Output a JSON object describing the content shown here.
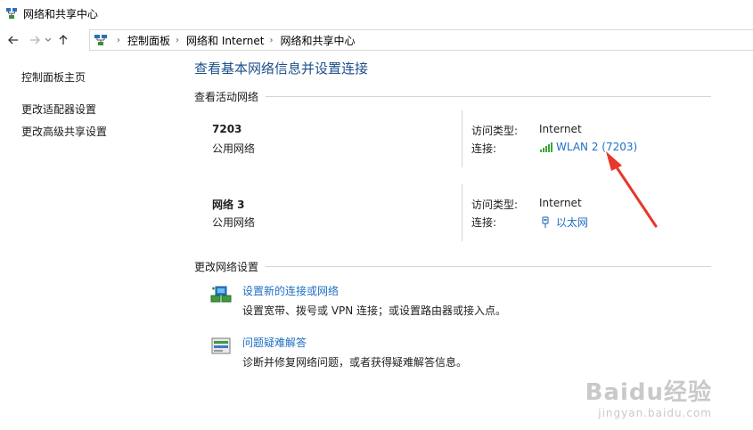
{
  "window": {
    "title": "网络和共享中心"
  },
  "nav": {
    "back_icon": "arrow-left-icon",
    "forward_icon": "arrow-right-icon",
    "recent_icon": "chevron-down-icon",
    "up_icon": "arrow-up-icon",
    "breadcrumbs": [
      "控制面板",
      "网络和 Internet",
      "网络和共享中心"
    ]
  },
  "sidebar": {
    "items": [
      {
        "label": "控制面板主页"
      },
      {
        "label": "更改适配器设置"
      },
      {
        "label": "更改高级共享设置"
      }
    ]
  },
  "main": {
    "heading": "查看基本网络信息并设置连接",
    "active_networks_header": "查看活动网络",
    "networks": [
      {
        "name": "7203",
        "category": "公用网络",
        "access_type_label": "访问类型:",
        "access_type_value": "Internet",
        "connection_label": "连接:",
        "connection_value": "WLAN 2 (7203)",
        "connection_icon": "wifi-signal-icon"
      },
      {
        "name": "网络  3",
        "category": "公用网络",
        "access_type_label": "访问类型:",
        "access_type_value": "Internet",
        "connection_label": "连接:",
        "connection_value": "以太网",
        "connection_icon": "ethernet-icon"
      }
    ],
    "change_settings_header": "更改网络设置",
    "tasks": [
      {
        "link": "设置新的连接或网络",
        "description": "设置宽带、拨号或 VPN 连接；或设置路由器或接入点。",
        "icon": "new-connection-icon"
      },
      {
        "link": "问题疑难解答",
        "description": "诊断并修复网络问题，或者获得疑难解答信息。",
        "icon": "troubleshoot-icon"
      }
    ]
  },
  "watermark": {
    "line1": "Baidu经验",
    "line2": "jingyan.baidu.com"
  },
  "colors": {
    "link": "#1f6fc5",
    "heading": "#1e4e8c",
    "annotation": "#e8372c"
  }
}
